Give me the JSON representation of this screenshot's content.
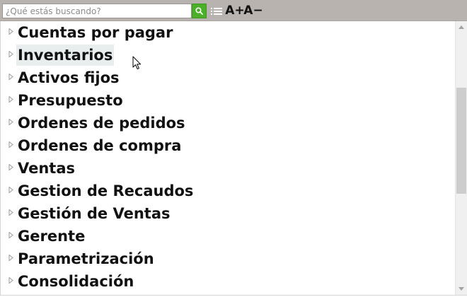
{
  "search": {
    "placeholder": "¿Qué estás buscando?",
    "value": ""
  },
  "toolbar": {
    "search_button_icon": "search-icon",
    "list_button_icon": "list-icon",
    "font_increase_label": "A+",
    "font_decrease_label": "A−"
  },
  "tree": {
    "items": [
      {
        "label": "Cuentas por pagar"
      },
      {
        "label": "Inventarios"
      },
      {
        "label": "Activos fijos"
      },
      {
        "label": "Presupuesto"
      },
      {
        "label": "Ordenes de pedidos"
      },
      {
        "label": "Ordenes de compra"
      },
      {
        "label": "Ventas"
      },
      {
        "label": "Gestion de Recaudos"
      },
      {
        "label": "Gestión de Ventas"
      },
      {
        "label": "Gerente"
      },
      {
        "label": "Parametrización"
      },
      {
        "label": "Consolidación"
      }
    ]
  },
  "colors": {
    "toolbar_bg": "#b8b3ae",
    "search_button": "#4caf2a",
    "hover_highlight": "#e8eeee",
    "scroll_thumb": "#cdcdcd"
  }
}
